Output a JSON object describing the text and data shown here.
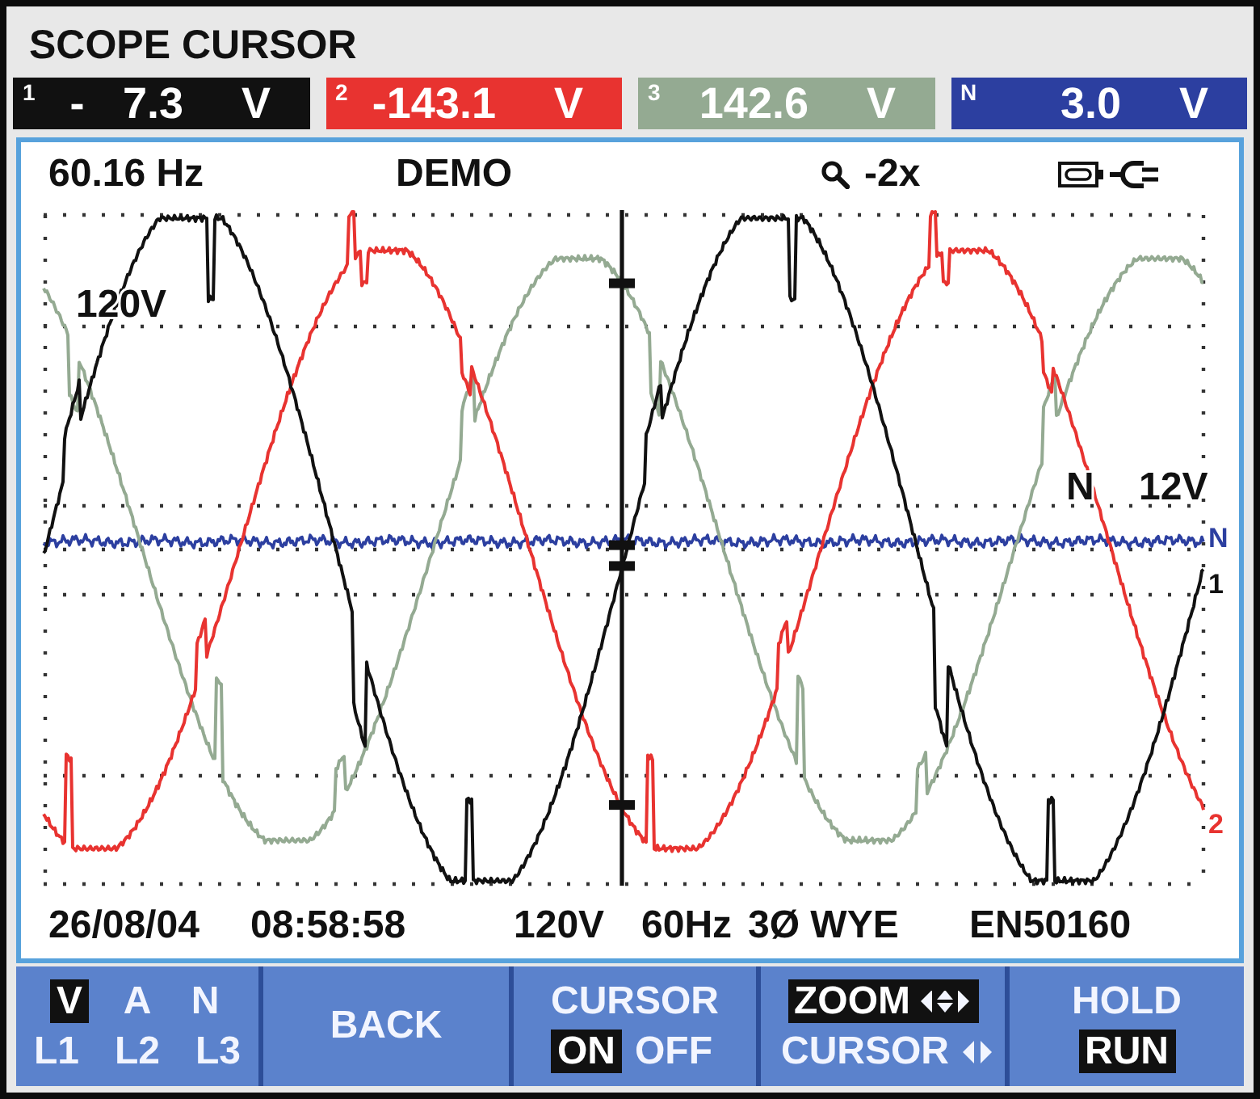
{
  "title": "SCOPE CURSOR",
  "channels": [
    {
      "kind": "phase",
      "number": "1",
      "value": "- 7.3",
      "unit": "V",
      "color": "#111111"
    },
    {
      "kind": "phase",
      "number": "2",
      "value": "-143.1",
      "unit": "V",
      "color": "#e83330"
    },
    {
      "kind": "phase",
      "number": "3",
      "value": "142.6",
      "unit": "V",
      "color": "#94aa92"
    },
    {
      "kind": "neutral",
      "number": "N",
      "value": "3.0",
      "unit": "V",
      "color": "#2c3fa0"
    }
  ],
  "info_bar": {
    "frequency": "60.16 Hz",
    "mode": "DEMO",
    "zoom": "-2x"
  },
  "scope": {
    "scale_label": "120V",
    "neutral_label": "N",
    "neutral_scale": "12V",
    "trace_labels": [
      {
        "text": "N",
        "color": "#2c3fa0"
      },
      {
        "text": "1",
        "color": "#111111"
      },
      {
        "text": "2",
        "color": "#e83330"
      }
    ]
  },
  "status_bar": {
    "date": "26/08/04",
    "time": "08:58:58",
    "nominal_voltage": "120V",
    "nominal_frequency": "60Hz",
    "configuration": "3Ø WYE",
    "standard": "EN50160"
  },
  "softkeys": [
    {
      "kind": "grid",
      "rows": [
        {
          "options": [
            {
              "label": "V",
              "selected": true
            },
            {
              "label": "A",
              "selected": false
            },
            {
              "label": "N",
              "selected": false
            }
          ]
        },
        {
          "options": [
            {
              "label": "L1",
              "selected": false
            },
            {
              "label": "L2",
              "selected": false
            },
            {
              "label": "L3",
              "selected": false
            }
          ]
        }
      ]
    },
    {
      "kind": "plain",
      "label": "BACK"
    },
    {
      "kind": "toggle",
      "title": "CURSOR",
      "options": [
        {
          "label": "ON",
          "selected": true
        },
        {
          "label": "OFF",
          "selected": false
        }
      ]
    },
    {
      "kind": "stack",
      "options": [
        {
          "kind": "zoom",
          "label": "ZOOM",
          "selected": true
        },
        {
          "kind": "cursor",
          "label": "CURSOR",
          "selected": false
        }
      ]
    },
    {
      "kind": "stack",
      "options": [
        {
          "label": "HOLD",
          "selected": false
        },
        {
          "label": "RUN",
          "selected": true
        }
      ]
    }
  ]
}
